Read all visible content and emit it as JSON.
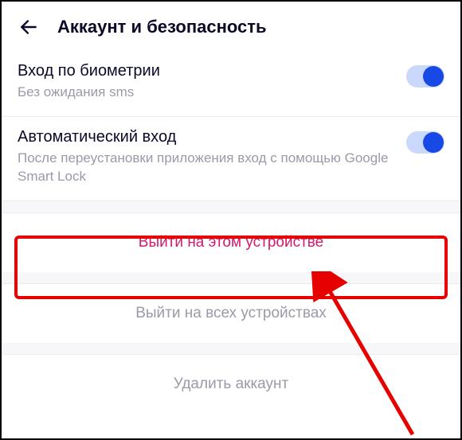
{
  "header": {
    "title": "Аккаунт и безопасность"
  },
  "settings": {
    "biometric": {
      "title": "Вход по биометрии",
      "subtitle": "Без ожидания sms",
      "enabled": true
    },
    "autologin": {
      "title": "Автоматический вход",
      "subtitle": "После переустановки приложения вход с помощью Google Smart Lock",
      "enabled": true
    }
  },
  "actions": {
    "logout_this": "Выйти на этом устройстве",
    "logout_all": "Выйти на всех устройствах",
    "delete": "Удалить аккаунт"
  },
  "colors": {
    "accent": "#1849e6",
    "danger": "#d31a6d",
    "highlight": "#e60000"
  }
}
